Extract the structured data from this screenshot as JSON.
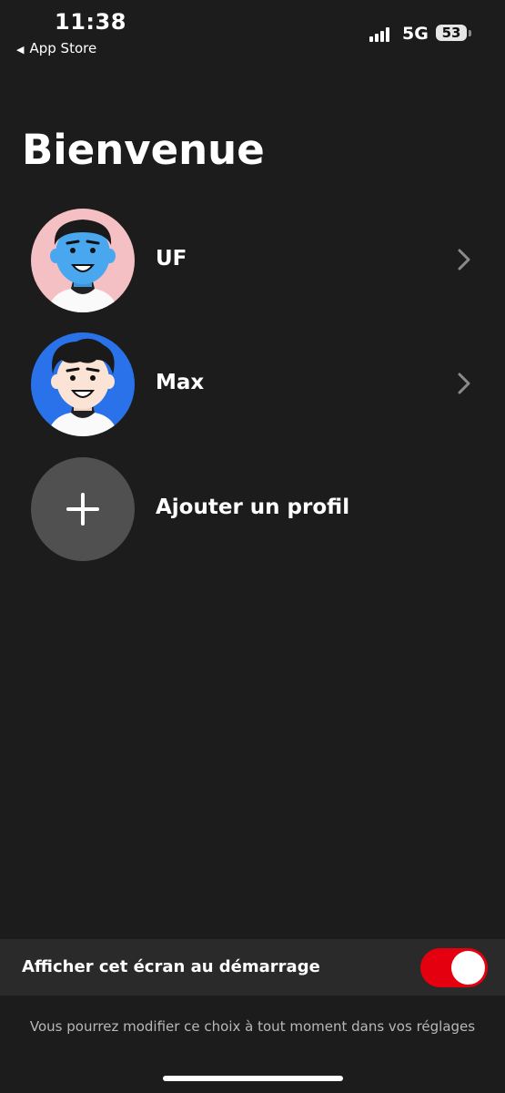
{
  "status_bar": {
    "time": "11:38",
    "back_label": "App Store",
    "network": "5G",
    "battery": "53"
  },
  "header": {
    "title": "Bienvenue"
  },
  "profiles": [
    {
      "name": "UF",
      "avatar_bg": "#f4c0c4",
      "skin": "#49a7f0",
      "icon": "chevron-right-icon"
    },
    {
      "name": "Max",
      "avatar_bg": "#2a72ea",
      "skin": "#fbe3d6",
      "icon": "chevron-right-icon"
    }
  ],
  "add_profile": {
    "label": "Ajouter un profil",
    "icon": "plus-icon"
  },
  "startup_setting": {
    "label": "Afficher cet écran au démarrage",
    "enabled": true,
    "accent": "#e4000f"
  },
  "hint": "Vous pourrez modifier ce choix à tout moment dans vos réglages"
}
